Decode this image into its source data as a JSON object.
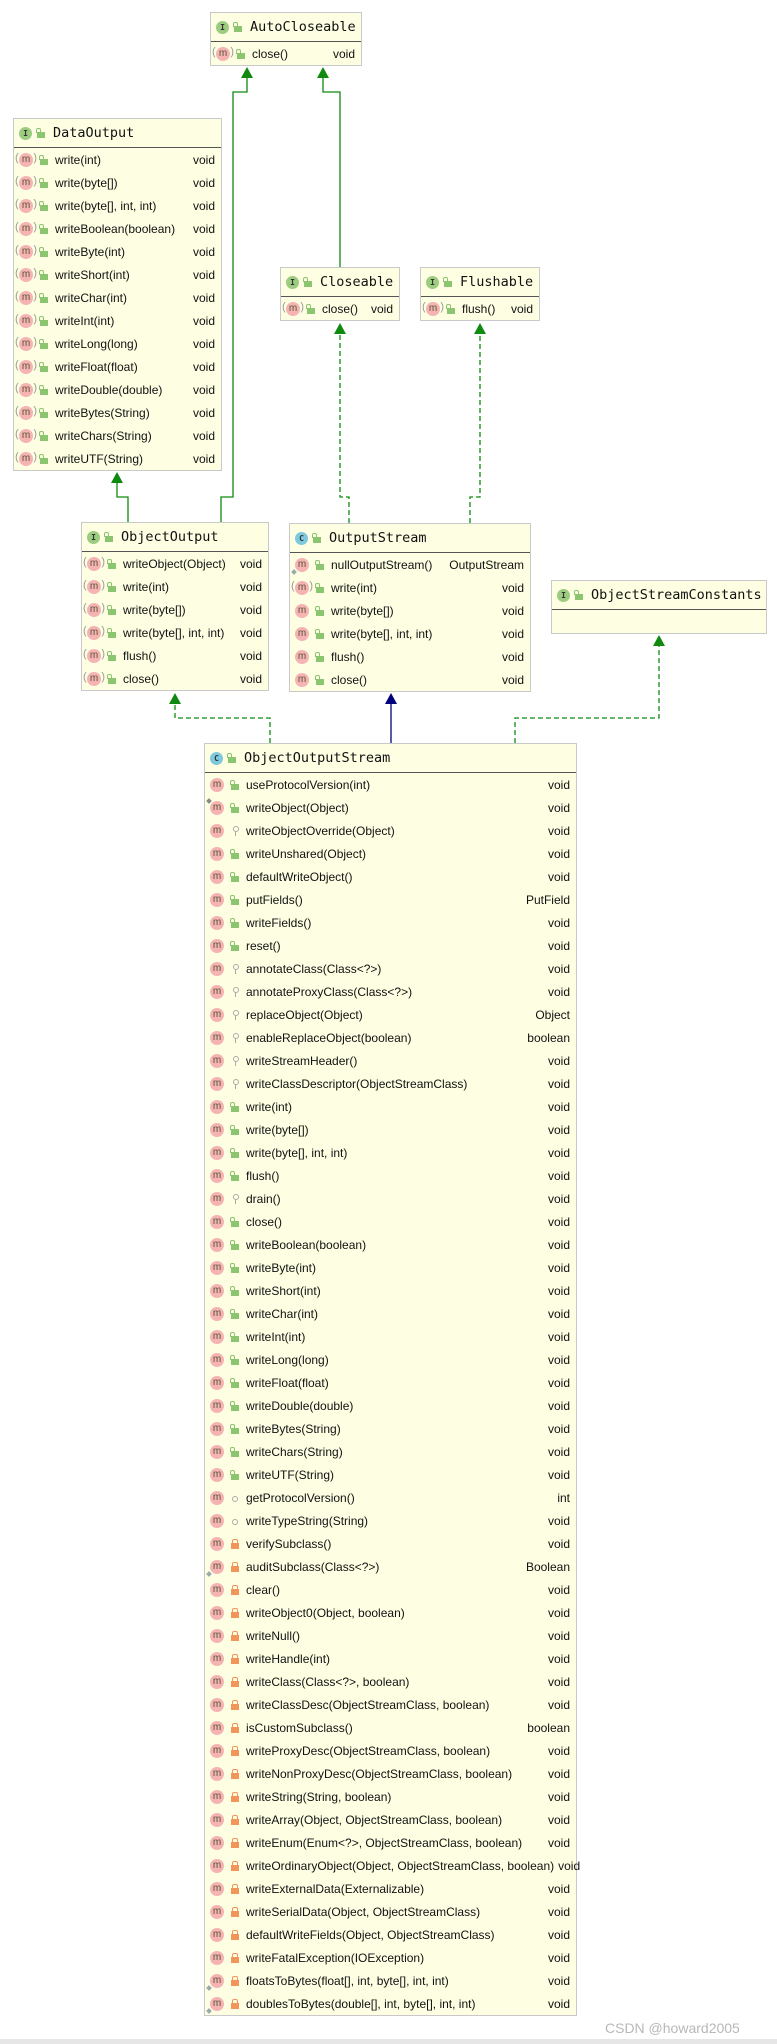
{
  "colors": {
    "box_bg": "#fefee3",
    "extends": "#0f8a0f",
    "implements": "#0f8a0f",
    "class_extends": "#00007f",
    "method_icon": "#f6b3b3",
    "interface_icon": "#9ccc7f",
    "class_icon": "#7fc9de"
  },
  "classes": [
    {
      "id": "AutoCloseable",
      "kind": "I",
      "name": "AutoCloseable",
      "methods": [
        {
          "name": "close()",
          "type": "void",
          "vis": "pub",
          "abstract": true
        }
      ]
    },
    {
      "id": "DataOutput",
      "kind": "I",
      "name": "DataOutput",
      "methods": [
        {
          "name": "write(int)",
          "type": "void",
          "vis": "pub",
          "abstract": true
        },
        {
          "name": "write(byte[])",
          "type": "void",
          "vis": "pub",
          "abstract": true
        },
        {
          "name": "write(byte[], int, int)",
          "type": "void",
          "vis": "pub",
          "abstract": true
        },
        {
          "name": "writeBoolean(boolean)",
          "type": "void",
          "vis": "pub",
          "abstract": true
        },
        {
          "name": "writeByte(int)",
          "type": "void",
          "vis": "pub",
          "abstract": true
        },
        {
          "name": "writeShort(int)",
          "type": "void",
          "vis": "pub",
          "abstract": true
        },
        {
          "name": "writeChar(int)",
          "type": "void",
          "vis": "pub",
          "abstract": true
        },
        {
          "name": "writeInt(int)",
          "type": "void",
          "vis": "pub",
          "abstract": true
        },
        {
          "name": "writeLong(long)",
          "type": "void",
          "vis": "pub",
          "abstract": true
        },
        {
          "name": "writeFloat(float)",
          "type": "void",
          "vis": "pub",
          "abstract": true
        },
        {
          "name": "writeDouble(double)",
          "type": "void",
          "vis": "pub",
          "abstract": true
        },
        {
          "name": "writeBytes(String)",
          "type": "void",
          "vis": "pub",
          "abstract": true
        },
        {
          "name": "writeChars(String)",
          "type": "void",
          "vis": "pub",
          "abstract": true
        },
        {
          "name": "writeUTF(String)",
          "type": "void",
          "vis": "pub",
          "abstract": true
        }
      ]
    },
    {
      "id": "Closeable",
      "kind": "I",
      "name": "Closeable",
      "methods": [
        {
          "name": "close()",
          "type": "void",
          "vis": "pub",
          "abstract": true
        }
      ]
    },
    {
      "id": "Flushable",
      "kind": "I",
      "name": "Flushable",
      "methods": [
        {
          "name": "flush()",
          "type": "void",
          "vis": "pub",
          "abstract": true
        }
      ]
    },
    {
      "id": "ObjectOutput",
      "kind": "I",
      "name": "ObjectOutput",
      "methods": [
        {
          "name": "writeObject(Object)",
          "type": "void",
          "vis": "pub",
          "abstract": true
        },
        {
          "name": "write(int)",
          "type": "void",
          "vis": "pub",
          "abstract": true
        },
        {
          "name": "write(byte[])",
          "type": "void",
          "vis": "pub",
          "abstract": true
        },
        {
          "name": "write(byte[], int, int)",
          "type": "void",
          "vis": "pub",
          "abstract": true
        },
        {
          "name": "flush()",
          "type": "void",
          "vis": "pub",
          "abstract": true
        },
        {
          "name": "close()",
          "type": "void",
          "vis": "pub",
          "abstract": true
        }
      ]
    },
    {
      "id": "OutputStream",
      "kind": "C",
      "name": "OutputStream",
      "methods": [
        {
          "name": "nullOutputStream()",
          "type": "OutputStream",
          "vis": "pub",
          "static": true
        },
        {
          "name": "write(int)",
          "type": "void",
          "vis": "pub",
          "abstract": true
        },
        {
          "name": "write(byte[])",
          "type": "void",
          "vis": "pub"
        },
        {
          "name": "write(byte[], int, int)",
          "type": "void",
          "vis": "pub"
        },
        {
          "name": "flush()",
          "type": "void",
          "vis": "pub"
        },
        {
          "name": "close()",
          "type": "void",
          "vis": "pub"
        }
      ]
    },
    {
      "id": "ObjectStreamConstants",
      "kind": "I",
      "name": "ObjectStreamConstants",
      "methods": []
    },
    {
      "id": "ObjectOutputStream",
      "kind": "C",
      "name": "ObjectOutputStream",
      "methods": [
        {
          "name": "useProtocolVersion(int)",
          "type": "void",
          "vis": "pub"
        },
        {
          "name": "writeObject(Object)",
          "type": "void",
          "vis": "pub",
          "final": true
        },
        {
          "name": "writeObjectOverride(Object)",
          "type": "void",
          "vis": "prot"
        },
        {
          "name": "writeUnshared(Object)",
          "type": "void",
          "vis": "pub"
        },
        {
          "name": "defaultWriteObject()",
          "type": "void",
          "vis": "pub"
        },
        {
          "name": "putFields()",
          "type": "PutField",
          "vis": "pub"
        },
        {
          "name": "writeFields()",
          "type": "void",
          "vis": "pub"
        },
        {
          "name": "reset()",
          "type": "void",
          "vis": "pub"
        },
        {
          "name": "annotateClass(Class<?>)",
          "type": "void",
          "vis": "prot"
        },
        {
          "name": "annotateProxyClass(Class<?>)",
          "type": "void",
          "vis": "prot"
        },
        {
          "name": "replaceObject(Object)",
          "type": "Object",
          "vis": "prot"
        },
        {
          "name": "enableReplaceObject(boolean)",
          "type": "boolean",
          "vis": "prot"
        },
        {
          "name": "writeStreamHeader()",
          "type": "void",
          "vis": "prot"
        },
        {
          "name": "writeClassDescriptor(ObjectStreamClass)",
          "type": "void",
          "vis": "prot"
        },
        {
          "name": "write(int)",
          "type": "void",
          "vis": "pub"
        },
        {
          "name": "write(byte[])",
          "type": "void",
          "vis": "pub"
        },
        {
          "name": "write(byte[], int, int)",
          "type": "void",
          "vis": "pub"
        },
        {
          "name": "flush()",
          "type": "void",
          "vis": "pub"
        },
        {
          "name": "drain()",
          "type": "void",
          "vis": "prot"
        },
        {
          "name": "close()",
          "type": "void",
          "vis": "pub"
        },
        {
          "name": "writeBoolean(boolean)",
          "type": "void",
          "vis": "pub"
        },
        {
          "name": "writeByte(int)",
          "type": "void",
          "vis": "pub"
        },
        {
          "name": "writeShort(int)",
          "type": "void",
          "vis": "pub"
        },
        {
          "name": "writeChar(int)",
          "type": "void",
          "vis": "pub"
        },
        {
          "name": "writeInt(int)",
          "type": "void",
          "vis": "pub"
        },
        {
          "name": "writeLong(long)",
          "type": "void",
          "vis": "pub"
        },
        {
          "name": "writeFloat(float)",
          "type": "void",
          "vis": "pub"
        },
        {
          "name": "writeDouble(double)",
          "type": "void",
          "vis": "pub"
        },
        {
          "name": "writeBytes(String)",
          "type": "void",
          "vis": "pub"
        },
        {
          "name": "writeChars(String)",
          "type": "void",
          "vis": "pub"
        },
        {
          "name": "writeUTF(String)",
          "type": "void",
          "vis": "pub"
        },
        {
          "name": "getProtocolVersion()",
          "type": "int",
          "vis": "pkg"
        },
        {
          "name": "writeTypeString(String)",
          "type": "void",
          "vis": "pkg"
        },
        {
          "name": "verifySubclass()",
          "type": "void",
          "vis": "priv"
        },
        {
          "name": "auditSubclass(Class<?>)",
          "type": "Boolean",
          "vis": "priv",
          "static": true
        },
        {
          "name": "clear()",
          "type": "void",
          "vis": "priv"
        },
        {
          "name": "writeObject0(Object, boolean)",
          "type": "void",
          "vis": "priv"
        },
        {
          "name": "writeNull()",
          "type": "void",
          "vis": "priv"
        },
        {
          "name": "writeHandle(int)",
          "type": "void",
          "vis": "priv"
        },
        {
          "name": "writeClass(Class<?>, boolean)",
          "type": "void",
          "vis": "priv"
        },
        {
          "name": "writeClassDesc(ObjectStreamClass, boolean)",
          "type": "void",
          "vis": "priv"
        },
        {
          "name": "isCustomSubclass()",
          "type": "boolean",
          "vis": "priv"
        },
        {
          "name": "writeProxyDesc(ObjectStreamClass, boolean)",
          "type": "void",
          "vis": "priv"
        },
        {
          "name": "writeNonProxyDesc(ObjectStreamClass, boolean)",
          "type": "void",
          "vis": "priv"
        },
        {
          "name": "writeString(String, boolean)",
          "type": "void",
          "vis": "priv"
        },
        {
          "name": "writeArray(Object, ObjectStreamClass, boolean)",
          "type": "void",
          "vis": "priv"
        },
        {
          "name": "writeEnum(Enum<?>, ObjectStreamClass, boolean)",
          "type": "void",
          "vis": "priv"
        },
        {
          "name": "writeOrdinaryObject(Object, ObjectStreamClass, boolean)",
          "type": "void",
          "vis": "priv"
        },
        {
          "name": "writeExternalData(Externalizable)",
          "type": "void",
          "vis": "priv"
        },
        {
          "name": "writeSerialData(Object, ObjectStreamClass)",
          "type": "void",
          "vis": "priv"
        },
        {
          "name": "defaultWriteFields(Object, ObjectStreamClass)",
          "type": "void",
          "vis": "priv"
        },
        {
          "name": "writeFatalException(IOException)",
          "type": "void",
          "vis": "priv"
        },
        {
          "name": "floatsToBytes(float[], int, byte[], int, int)",
          "type": "void",
          "vis": "priv",
          "static": true
        },
        {
          "name": "doublesToBytes(double[], int, byte[], int, int)",
          "type": "void",
          "vis": "priv",
          "static": true
        }
      ]
    }
  ],
  "relations": [
    {
      "from": "ObjectOutput",
      "to": "AutoCloseable",
      "style": "extends"
    },
    {
      "from": "Closeable",
      "to": "AutoCloseable",
      "style": "extends"
    },
    {
      "from": "ObjectOutput",
      "to": "DataOutput",
      "style": "extends"
    },
    {
      "from": "OutputStream",
      "to": "Closeable",
      "style": "implements"
    },
    {
      "from": "OutputStream",
      "to": "Flushable",
      "style": "implements"
    },
    {
      "from": "ObjectOutputStream",
      "to": "ObjectOutput",
      "style": "implements"
    },
    {
      "from": "ObjectOutputStream",
      "to": "OutputStream",
      "style": "class_extends"
    },
    {
      "from": "ObjectOutputStream",
      "to": "ObjectStreamConstants",
      "style": "implements"
    }
  ],
  "watermark": "CSDN @howard2005"
}
